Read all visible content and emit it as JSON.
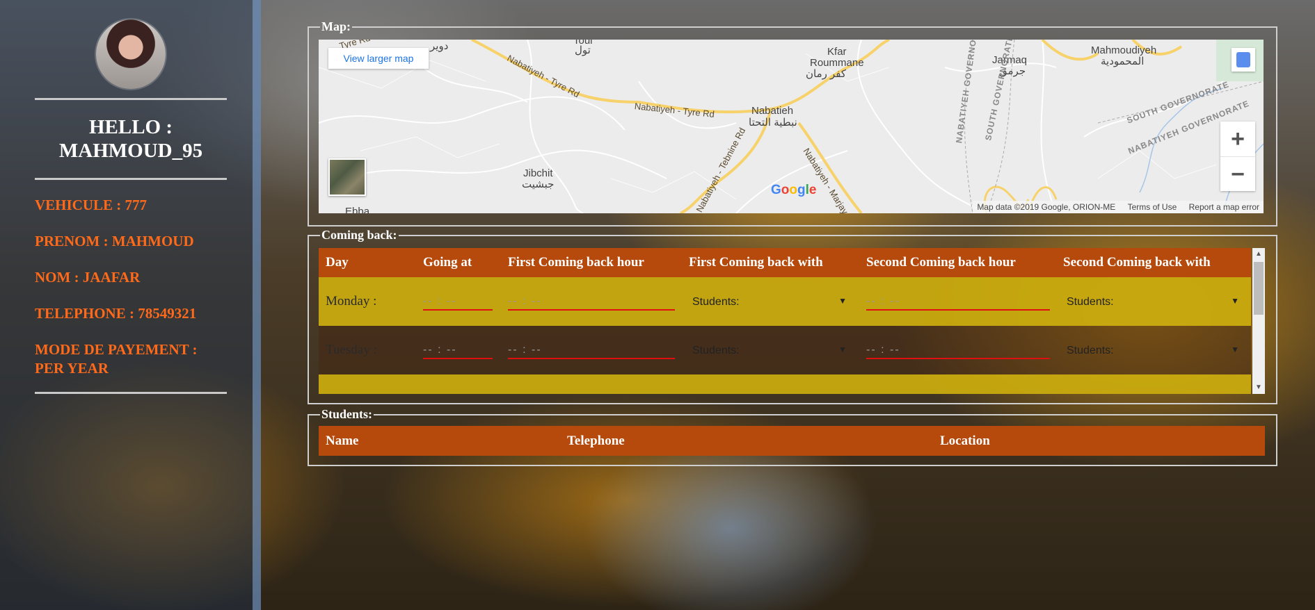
{
  "profile": {
    "hello": "HELLO : MAHMOUD_95",
    "vehicule": "VEHICULE : 777",
    "prenom": "PRENOM : MAHMOUD",
    "nom": "NOM : JAAFAR",
    "telephone": "TELEPHONE : 78549321",
    "mode_payement": "MODE DE PAYEMENT : PER YEAR"
  },
  "map_section": {
    "legend": "Map:",
    "view_larger": "View larger map",
    "labels": {
      "kfar_roummane": "Kfar\nRoummane",
      "kfar_roummane_ar": "كفر رمان",
      "nabatieh": "Nabatieh",
      "nabatieh_ar": "نبطية التحتا",
      "jarmaq": "Jarmaq",
      "jarmaq_ar": "جرمق",
      "mahmoudiyeh": "Mahmoudiyeh",
      "mahmoudiyeh_ar": "المحمودية",
      "jibchit": "Jibchit",
      "jibchit_ar": "جبشيت",
      "touil": "Toul",
      "touil_ar": "تول",
      "doueir_ar": "دوير",
      "ebba": "Ebba",
      "road1": "Nabatiyeh - Tyre Rd",
      "road2": "Nabatiyeh - Tyre Rd",
      "road3": "Nabatiyeh - Tebnine Rd",
      "road4": "Nabatiyeh - Marjayo",
      "road5": "Tyre Rd",
      "gov1": "NABATIYEH GOVERNORATE",
      "gov2": "SOUTH GOVERNORATE",
      "gov3": "SOUTH GOVERNORATE",
      "gov4": "NABATIYEH GOVERNORATE"
    },
    "google": "Google",
    "attribution": {
      "data": "Map data ©2019 Google, ORION-ME",
      "terms": "Terms of Use",
      "report": "Report a map error"
    }
  },
  "coming_back": {
    "legend": "Coming back:",
    "headers": [
      "Day",
      "Going at",
      "First Coming back hour",
      "First Coming back with",
      "Second Coming back hour",
      "Second Coming back with"
    ],
    "time_placeholder": "-- : --",
    "select_label": "Students:",
    "rows": [
      {
        "day": "Monday :"
      },
      {
        "day": "Tuesday :"
      }
    ]
  },
  "students": {
    "legend": "Students:",
    "headers": [
      "Name",
      "Telephone",
      "Location"
    ]
  },
  "colors": {
    "accent_orange": "#ff6a1a",
    "header_bg": "#b64a0c",
    "row_yellow": "#c8aa0f",
    "input_underline": "#e01010"
  }
}
